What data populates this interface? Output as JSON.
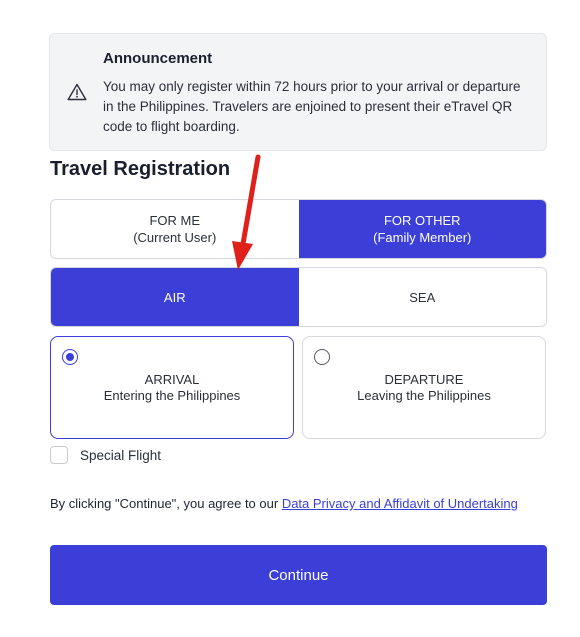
{
  "announcement": {
    "icon": "warning-icon",
    "title": "Announcement",
    "body": "You may only register within 72 hours prior to your arrival or departure in the Philippines. Travelers are enjoined to present their eTravel QR code to flight boarding."
  },
  "registration": {
    "title": "Travel Registration",
    "for_me": {
      "line1": "FOR ME",
      "line2": "(Current User)",
      "selected": false
    },
    "for_other": {
      "line1": "FOR OTHER",
      "line2": "(Family Member)",
      "selected": true
    },
    "air": {
      "label": "AIR",
      "selected": true
    },
    "sea": {
      "label": "SEA",
      "selected": false
    },
    "arrival": {
      "line1": "ARRIVAL",
      "line2": "Entering the Philippines",
      "selected": true
    },
    "departure": {
      "line1": "DEPARTURE",
      "line2": "Leaving the Philippines",
      "selected": false
    },
    "special_flight": {
      "label": "Special Flight",
      "checked": false
    },
    "agree_text": "By clicking \"Continue\", you agree to our ",
    "agree_link": "Data Privacy and Affidavit of Undertaking",
    "continue_label": "Continue"
  },
  "colors": {
    "accent": "#3b3fd8",
    "annotation_arrow": "#e0201b",
    "announcement_bg": "#f3f4f6"
  }
}
